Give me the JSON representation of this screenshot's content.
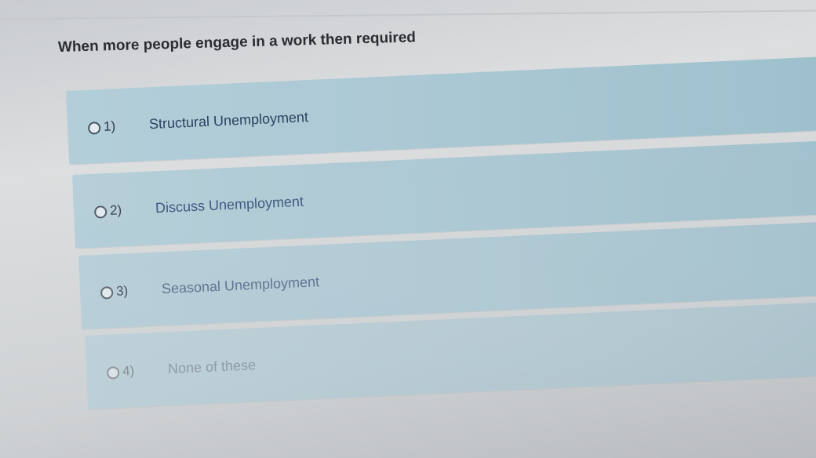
{
  "question": {
    "text": "When more people engage in a work then required"
  },
  "options": [
    {
      "number": "1)",
      "label": "Structural Unemployment"
    },
    {
      "number": "2)",
      "label": "Discuss Unemployment"
    },
    {
      "number": "3)",
      "label": "Seasonal Unemployment"
    },
    {
      "number": "4)",
      "label": "None of these"
    }
  ]
}
